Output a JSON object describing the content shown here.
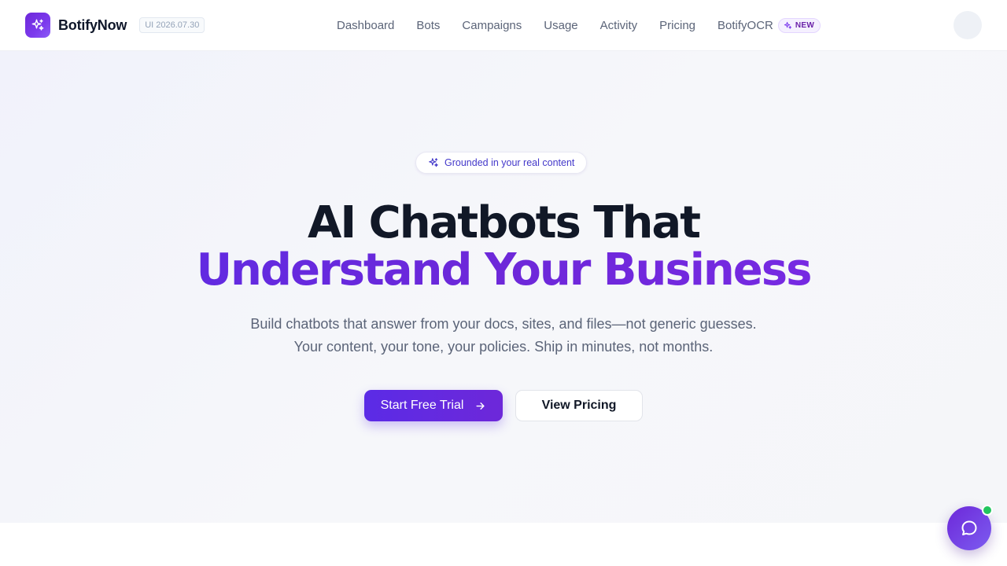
{
  "header": {
    "brand_name": "BotifyNow",
    "version": "UI 2026.07.30",
    "brand_icon": "sparkle-icon",
    "nav": [
      {
        "label": "Dashboard"
      },
      {
        "label": "Bots"
      },
      {
        "label": "Campaigns"
      },
      {
        "label": "Usage"
      },
      {
        "label": "Activity"
      },
      {
        "label": "Pricing"
      },
      {
        "label": "BotifyOCR"
      }
    ],
    "new_badge": "NEW"
  },
  "hero": {
    "pill_text": "Grounded in your real content",
    "headline_line1": "AI Chatbots That",
    "headline_line2": "Understand Your Business",
    "subtitle": "Build chatbots that answer from your docs, sites, and files—not generic guesses. Your content, your tone, your policies. Ship in minutes, not months.",
    "primary_cta": "Start Free Trial",
    "secondary_cta": "View Pricing"
  },
  "colors": {
    "accent": "#6d28d9",
    "accent_light": "#7c3aed",
    "online_status": "#22c55e"
  },
  "chat_widget": {
    "icon": "chat-bubble-icon",
    "status": "online"
  }
}
